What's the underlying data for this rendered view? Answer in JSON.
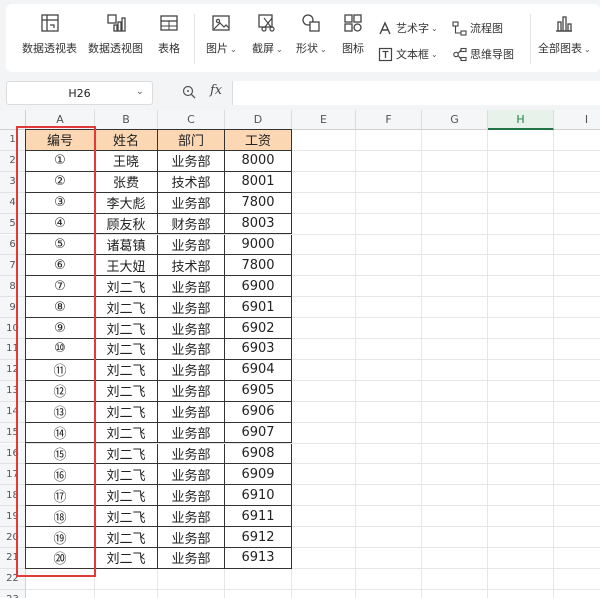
{
  "ribbon": {
    "pivot_table": "数据透视表",
    "pivot_chart": "数据透视图",
    "table": "表格",
    "picture": "图片",
    "screenshot": "截屏",
    "shapes": "形状",
    "icons": "图标",
    "wordart": "艺术字",
    "textbox": "文本框",
    "flowchart": "流程图",
    "mindmap": "思维导图",
    "all_charts": "全部图表"
  },
  "formula_bar": {
    "name_box": "H26",
    "fx": "fx",
    "formula": ""
  },
  "columns": [
    "A",
    "B",
    "C",
    "D",
    "E",
    "F",
    "G",
    "H",
    "I"
  ],
  "active_column": "H",
  "rows": [
    "1",
    "2",
    "3",
    "4",
    "5",
    "6",
    "7",
    "8",
    "9",
    "10",
    "11",
    "12",
    "13",
    "14",
    "15",
    "16",
    "17",
    "18",
    "19",
    "20",
    "21",
    "22",
    "23"
  ],
  "table": {
    "headers": [
      "编号",
      "姓名",
      "部门",
      "工资"
    ],
    "rows": [
      [
        "①",
        "王晓",
        "业务部",
        "8000"
      ],
      [
        "②",
        "张费",
        "技术部",
        "8001"
      ],
      [
        "③",
        "李大彪",
        "业务部",
        "7800"
      ],
      [
        "④",
        "顾友秋",
        "财务部",
        "8003"
      ],
      [
        "⑤",
        "诸葛镇",
        "业务部",
        "9000"
      ],
      [
        "⑥",
        "王大妞",
        "技术部",
        "7800"
      ],
      [
        "⑦",
        "刘二飞",
        "业务部",
        "6900"
      ],
      [
        "⑧",
        "刘二飞",
        "业务部",
        "6901"
      ],
      [
        "⑨",
        "刘二飞",
        "业务部",
        "6902"
      ],
      [
        "⑩",
        "刘二飞",
        "业务部",
        "6903"
      ],
      [
        "⑪",
        "刘二飞",
        "业务部",
        "6904"
      ],
      [
        "⑫",
        "刘二飞",
        "业务部",
        "6905"
      ],
      [
        "⑬",
        "刘二飞",
        "业务部",
        "6906"
      ],
      [
        "⑭",
        "刘二飞",
        "业务部",
        "6907"
      ],
      [
        "⑮",
        "刘二飞",
        "业务部",
        "6908"
      ],
      [
        "⑯",
        "刘二飞",
        "业务部",
        "6909"
      ],
      [
        "⑰",
        "刘二飞",
        "业务部",
        "6910"
      ],
      [
        "⑱",
        "刘二飞",
        "业务部",
        "6911"
      ],
      [
        "⑲",
        "刘二飞",
        "业务部",
        "6912"
      ],
      [
        "⑳",
        "刘二飞",
        "业务部",
        "6913"
      ]
    ]
  },
  "colors": {
    "header_fill": "#fbd7b4",
    "highlight_frame": "#e03b3b",
    "active_col": "#217346"
  }
}
